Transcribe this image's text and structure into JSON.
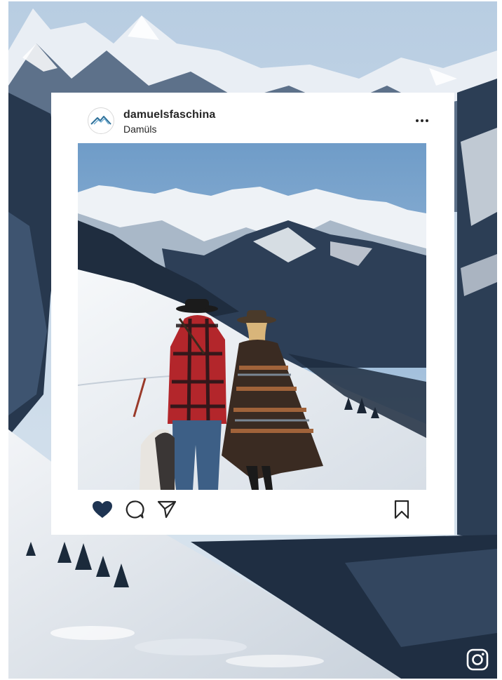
{
  "post": {
    "username": "damuelsfaschina",
    "location": "Damüls",
    "liked": true
  },
  "icons": {
    "avatar": "mountain-logo-icon",
    "more": "more-options-icon",
    "like": "heart-icon",
    "comment": "comment-icon",
    "share": "send-icon",
    "save": "bookmark-icon",
    "brand": "instagram-icon"
  },
  "colors": {
    "like_active": "#1e3452",
    "text": "#262626",
    "card": "#ffffff",
    "avatar_accent": "#2d6f98"
  }
}
